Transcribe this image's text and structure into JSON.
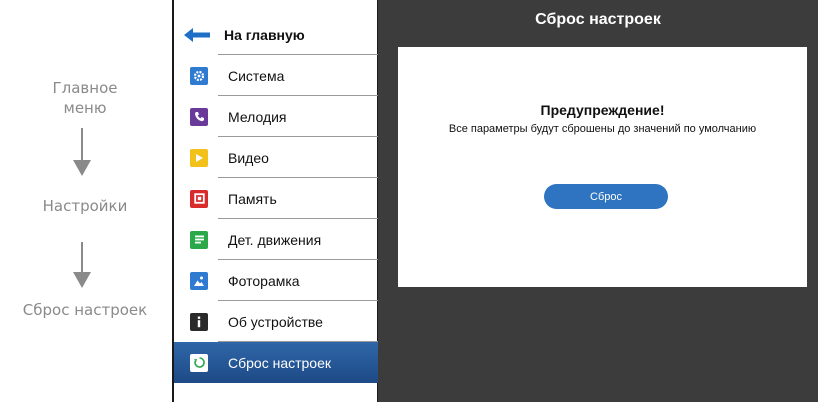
{
  "flow": {
    "step1": "Главное\nменю",
    "step2": "Настройки",
    "step3": "Сброс настроек"
  },
  "menu": {
    "back_label": "На главную",
    "items": [
      {
        "label": "Система",
        "icon": "gear-icon",
        "color": "#2e7bd1"
      },
      {
        "label": "Мелодия",
        "icon": "phone-icon",
        "color": "#6a3a9a"
      },
      {
        "label": "Видео",
        "icon": "play-icon",
        "color": "#f2c11a"
      },
      {
        "label": "Память",
        "icon": "memory-icon",
        "color": "#d92b2b"
      },
      {
        "label": "Дет. движения",
        "icon": "motion-list-icon",
        "color": "#2aa84a"
      },
      {
        "label": "Фоторамка",
        "icon": "photo-icon",
        "color": "#2e7bd1"
      },
      {
        "label": "Об устройстве",
        "icon": "info-icon",
        "color": "#2a2a2a"
      },
      {
        "label": "Сброс настроек",
        "icon": "reset-icon",
        "color": "#ffffff",
        "active": true
      }
    ]
  },
  "content": {
    "title": "Сброс настроек",
    "warning_title": "Предупреждение!",
    "warning_text": "Все параметры будут сброшены до значений по умолчанию",
    "reset_button": "Сброс"
  },
  "colors": {
    "accent": "#2e74c0",
    "panel_bg": "#3c3c3c",
    "active_item": "#2f66a8"
  }
}
